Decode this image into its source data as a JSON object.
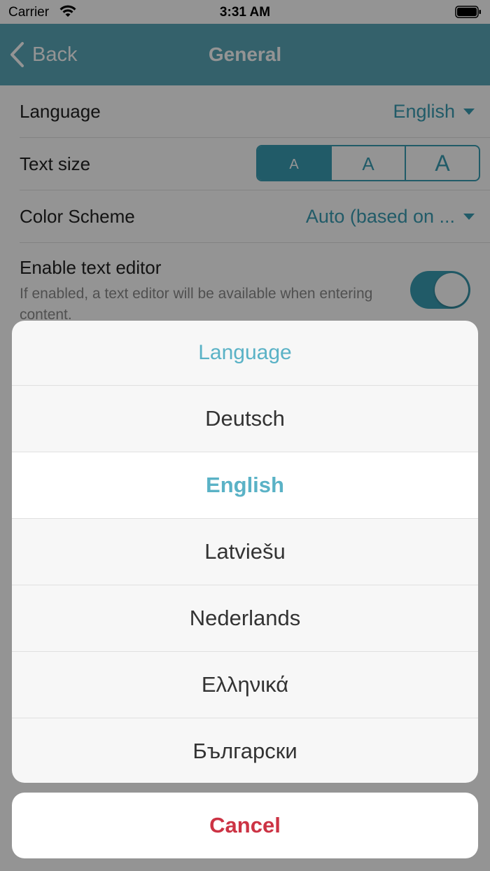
{
  "status_bar": {
    "carrier": "Carrier",
    "time": "3:31 AM"
  },
  "nav": {
    "back_label": "Back",
    "title": "General"
  },
  "settings": {
    "language": {
      "label": "Language",
      "value": "English"
    },
    "text_size": {
      "label": "Text size",
      "options": [
        "A",
        "A",
        "A"
      ],
      "selected_index": 0
    },
    "color_scheme": {
      "label": "Color Scheme",
      "value": "Auto (based on ..."
    },
    "text_editor": {
      "label": "Enable text editor",
      "description": "If enabled, a text editor will be available when entering content.",
      "enabled": true
    }
  },
  "action_sheet": {
    "title": "Language",
    "options": [
      "Deutsch",
      "English",
      "Latviešu",
      "Nederlands",
      "Ελληνικά",
      "Български"
    ],
    "selected": "English",
    "cancel_label": "Cancel"
  },
  "colors": {
    "accent": "#3a9db3",
    "navbar": "#5ba8b8",
    "cancel": "#cc3344"
  }
}
